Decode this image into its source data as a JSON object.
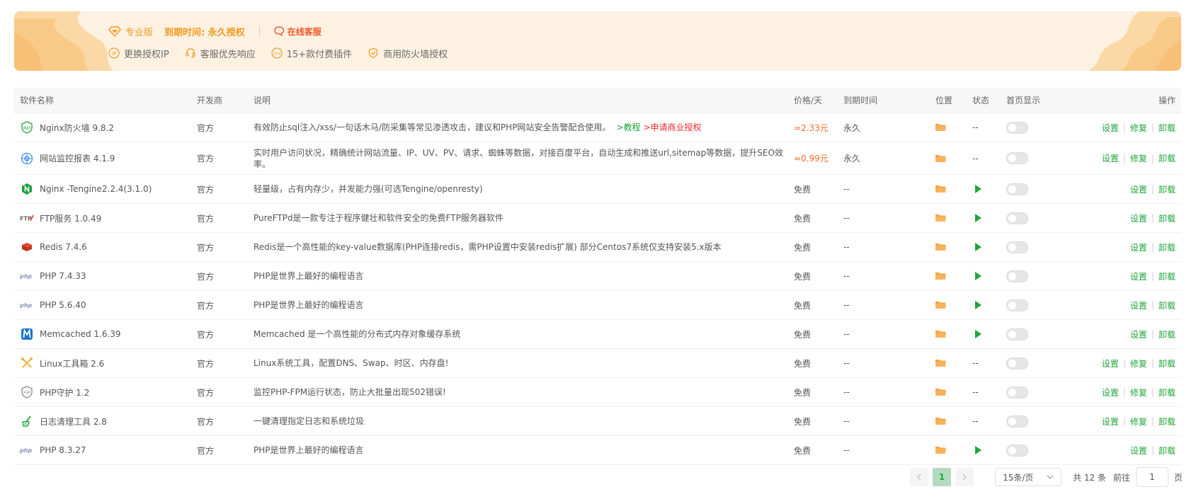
{
  "banner": {
    "edition": "专业版",
    "expiry": "到期时间: 永久授权",
    "service": "在线客服",
    "features": [
      {
        "icon": "ip-icon",
        "label": "更换授权IP"
      },
      {
        "icon": "headset-icon",
        "label": "客服优先响应"
      },
      {
        "icon": "plugin-count-icon",
        "label": "15+款付费插件"
      },
      {
        "icon": "shield-check-icon",
        "label": "商用防火墙授权"
      }
    ]
  },
  "table": {
    "headers": {
      "name": "软件名称",
      "developer": "开发商",
      "description": "说明",
      "price": "价格/天",
      "expiry": "到期时间",
      "location": "位置",
      "status": "状态",
      "homepage": "首页显示",
      "actions": "操作"
    },
    "op_labels": {
      "settings": "设置",
      "repair": "修复",
      "uninstall": "卸载"
    },
    "rows": [
      {
        "icon": "waf-icon",
        "name": "Nginx防火墙 9.8.2",
        "developer": "官方",
        "description": "有效防止sql注入/xss/一句话木马/防采集等常见渗透攻击，建议和PHP网站安全告警配合使用。",
        "link_tutorial": ">教程",
        "link_apply": ">申请商业授权",
        "price": "≈2.33元",
        "expiry": "永久",
        "status": "--"
      },
      {
        "icon": "site-monitor-icon",
        "name": "网站监控报表 4.1.9",
        "developer": "官方",
        "description": "实时用户访问状况，精确统计网站流量、IP、UV、PV、请求、蜘蛛等数据，对接百度平台，自动生成和推送url,sitemap等数据，提升SEO效率。",
        "price": "≈0.99元",
        "expiry": "永久",
        "status": "--"
      },
      {
        "icon": "nginx-icon",
        "name": "Nginx -Tengine2.2.4(3.1.0)",
        "developer": "官方",
        "description": "轻量级，占有内存少，并发能力强(可选Tengine/openresty)",
        "price": "免费",
        "expiry": "--"
      },
      {
        "icon": "ftp-icon",
        "name": "FTP服务 1.0.49",
        "developer": "官方",
        "description": "PureFTPd是一款专注于程序健壮和软件安全的免费FTP服务器软件",
        "price": "免费",
        "expiry": "--"
      },
      {
        "icon": "redis-icon",
        "name": "Redis 7.4.6",
        "developer": "官方",
        "description": "Redis是一个高性能的key-value数据库(PHP连接redis，需PHP设置中安装redis扩展) 部分Centos7系统仅支持安装5.x版本",
        "price": "免费",
        "expiry": "--"
      },
      {
        "icon": "php-icon",
        "name": "PHP 7.4.33",
        "developer": "官方",
        "description": "PHP是世界上最好的编程语言",
        "price": "免费",
        "expiry": "--"
      },
      {
        "icon": "php-icon",
        "name": "PHP 5.6.40",
        "developer": "官方",
        "description": "PHP是世界上最好的编程语言",
        "price": "免费",
        "expiry": "--"
      },
      {
        "icon": "memcached-icon",
        "name": "Memcached 1.6.39",
        "developer": "官方",
        "description": "Memcached 是一个高性能的分布式内存对象缓存系统",
        "price": "免费",
        "expiry": "--"
      },
      {
        "icon": "linux-tools-icon",
        "name": "Linux工具箱 2.6",
        "developer": "官方",
        "description": "Linux系统工具，配置DNS、Swap、时区、内存盘!",
        "price": "免费",
        "expiry": "--",
        "status": "--"
      },
      {
        "icon": "php-guard-icon",
        "name": "PHP守护 1.2",
        "developer": "官方",
        "description": "监控PHP-FPM运行状态，防止大批量出现502错误!",
        "price": "免费",
        "expiry": "--",
        "status": "--"
      },
      {
        "icon": "log-cleaner-icon",
        "name": "日志清理工具 2.8",
        "developer": "官方",
        "description": "一键清理指定日志和系统垃圾",
        "price": "免费",
        "expiry": "--",
        "status": "--"
      },
      {
        "icon": "php-icon",
        "name": "PHP 8.3.27",
        "developer": "官方",
        "description": "PHP是世界上最好的编程语言",
        "price": "免费",
        "expiry": "--"
      }
    ]
  },
  "pagination": {
    "current_page": "1",
    "page_size": "15条/页",
    "total": "共 12 条",
    "goto_label": "前往",
    "goto_value": "1",
    "page_suffix": "页"
  },
  "colors": {
    "accent_green": "#20a53a",
    "banner_orange": "#f39b21",
    "price_orange": "#f46b2c",
    "link_red": "#f0282d",
    "folder_orange": "#f5a443"
  }
}
